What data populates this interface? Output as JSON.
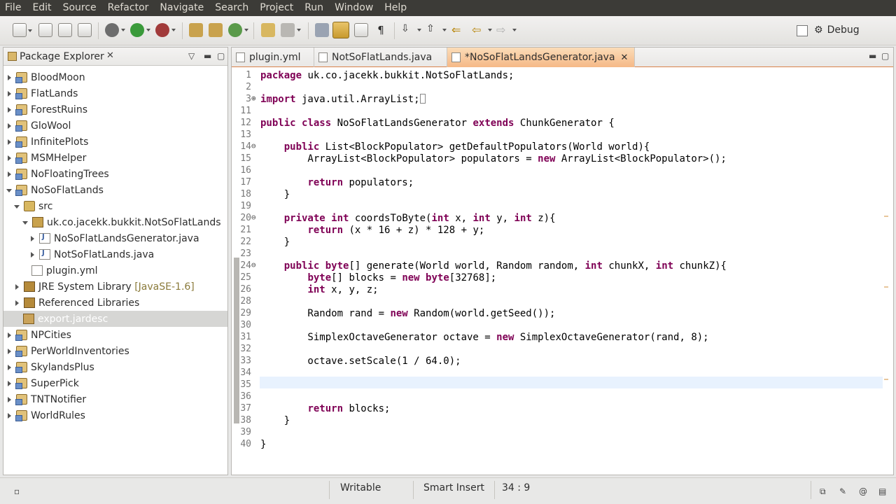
{
  "menu": [
    "File",
    "Edit",
    "Source",
    "Refactor",
    "Navigate",
    "Search",
    "Project",
    "Run",
    "Window",
    "Help"
  ],
  "toolbar": {
    "perspective_label": "Debug"
  },
  "package_explorer": {
    "title": "Package Explorer",
    "items": [
      {
        "label": "BloodMoon"
      },
      {
        "label": "FlatLands"
      },
      {
        "label": "ForestRuins"
      },
      {
        "label": "GloWool"
      },
      {
        "label": "InfinitePlots"
      },
      {
        "label": "MSMHelper"
      },
      {
        "label": "NoFloatingTrees"
      },
      {
        "label": "NoSoFlatLands"
      },
      {
        "label": "src"
      },
      {
        "label": "uk.co.jacekk.bukkit.NotSoFlatLands"
      },
      {
        "label": "NoSoFlatLandsGenerator.java"
      },
      {
        "label": "NotSoFlatLands.java"
      },
      {
        "label": "plugin.yml"
      },
      {
        "label": "JRE System Library"
      },
      {
        "label": "Referenced Libraries"
      },
      {
        "label": "export.jardesc"
      },
      {
        "label": "NPCities"
      },
      {
        "label": "PerWorldInventories"
      },
      {
        "label": "SkylandsPlus"
      },
      {
        "label": "SuperPick"
      },
      {
        "label": "TNTNotifier"
      },
      {
        "label": "WorldRules"
      }
    ],
    "jre_extra": "[JavaSE-1.6]"
  },
  "editor": {
    "tabs": [
      {
        "label": "plugin.yml"
      },
      {
        "label": "NotSoFlatLands.java"
      },
      {
        "label": "*NoSoFlatLandsGenerator.java"
      }
    ],
    "lines": [
      {
        "n": "1",
        "t": "package uk.co.jacekk.bukkit.NotSoFlatLands;"
      },
      {
        "n": "2",
        "t": ""
      },
      {
        "n": "3",
        "t": "import java.util.ArrayList;"
      },
      {
        "n": "11",
        "t": ""
      },
      {
        "n": "12",
        "t": "public class NoSoFlatLandsGenerator extends ChunkGenerator {"
      },
      {
        "n": "13",
        "t": ""
      },
      {
        "n": "14",
        "t": "    public List<BlockPopulator> getDefaultPopulators(World world){"
      },
      {
        "n": "15",
        "t": "        ArrayList<BlockPopulator> populators = new ArrayList<BlockPopulator>();"
      },
      {
        "n": "16",
        "t": ""
      },
      {
        "n": "17",
        "t": "        return populators;"
      },
      {
        "n": "18",
        "t": "    }"
      },
      {
        "n": "19",
        "t": ""
      },
      {
        "n": "20",
        "t": "    private int coordsToByte(int x, int y, int z){"
      },
      {
        "n": "21",
        "t": "        return (x * 16 + z) * 128 + y;"
      },
      {
        "n": "22",
        "t": "    }"
      },
      {
        "n": "23",
        "t": ""
      },
      {
        "n": "24",
        "t": "    public byte[] generate(World world, Random random, int chunkX, int chunkZ){"
      },
      {
        "n": "25",
        "t": "        byte[] blocks = new byte[32768];"
      },
      {
        "n": "26",
        "t": "        int x, y, z;"
      },
      {
        "n": "28",
        "t": "        Random rand = new Random(world.getSeed());"
      },
      {
        "n": "29",
        "t": ""
      },
      {
        "n": "30",
        "t": "        SimplexOctaveGenerator octave = new SimplexOctaveGenerator(rand, 8);"
      },
      {
        "n": "31",
        "t": ""
      },
      {
        "n": "32",
        "t": "        octave.setScale(1 / 64.0);"
      },
      {
        "n": "33",
        "t": ""
      },
      {
        "n": "34",
        "t": ""
      },
      {
        "n": "35",
        "t": ""
      },
      {
        "n": "36",
        "t": "        return blocks;"
      },
      {
        "n": "37",
        "t": "    }"
      },
      {
        "n": "38",
        "t": ""
      },
      {
        "n": "39",
        "t": "}"
      },
      {
        "n": "40",
        "t": ""
      }
    ]
  },
  "status": {
    "writable": "Writable",
    "insert_mode": "Smart Insert",
    "cursor_pos": "34 : 9"
  }
}
